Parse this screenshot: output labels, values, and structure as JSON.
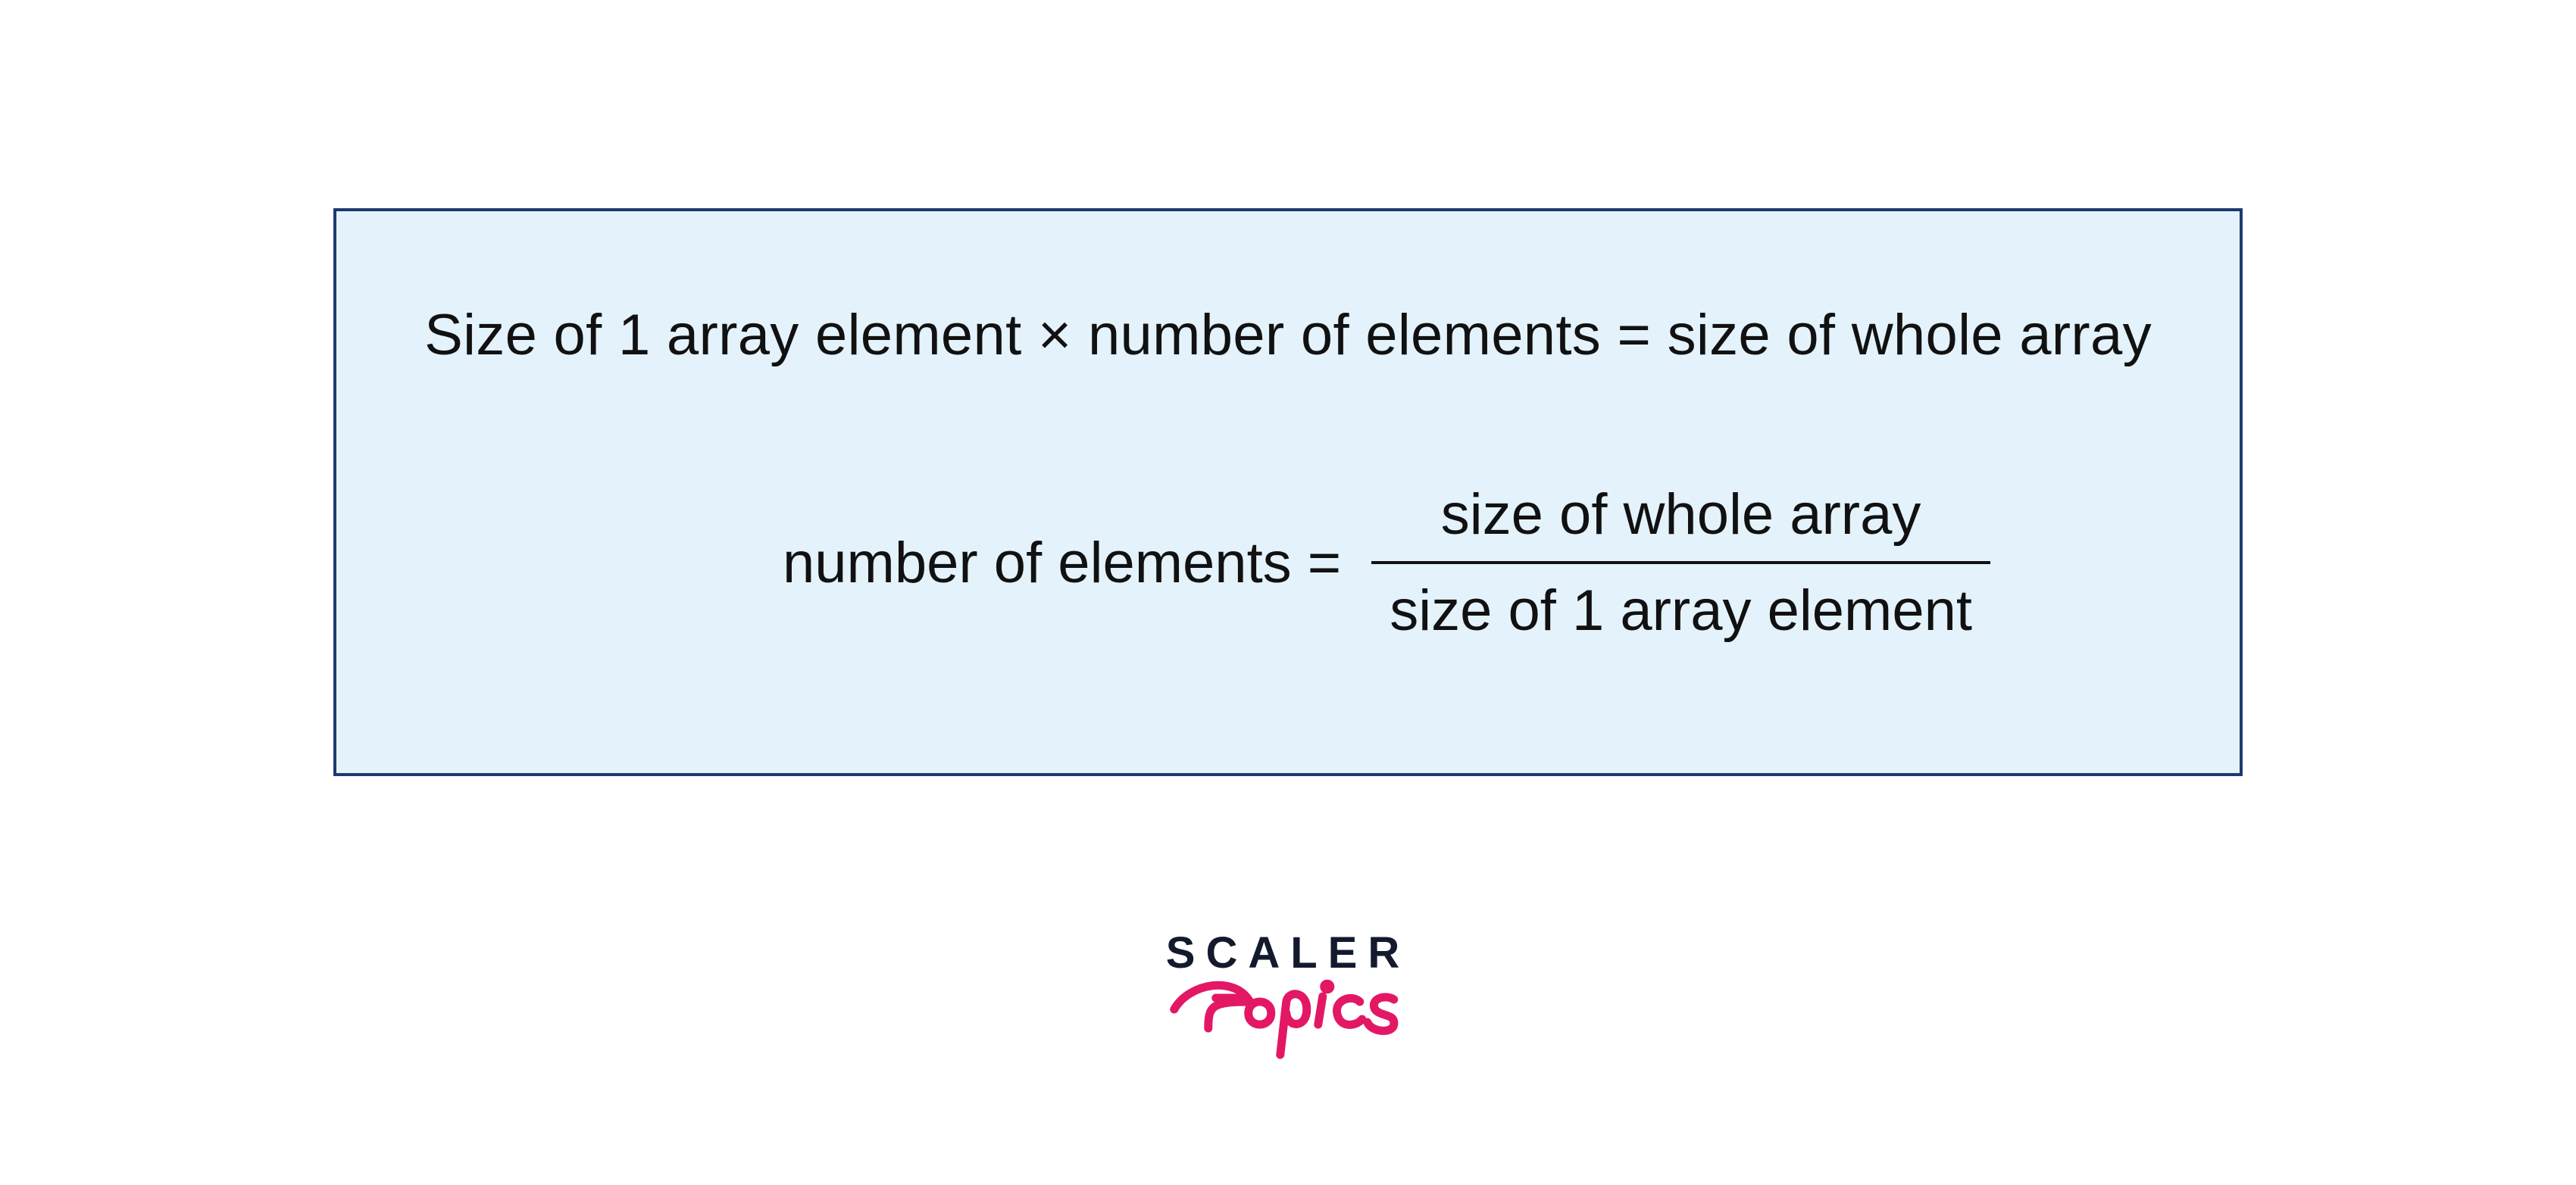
{
  "formula": {
    "equation1": "Size of 1 array element × number of elements = size of whole array",
    "equation2_lhs": "number of elements =",
    "equation2_numerator": "size of whole array",
    "equation2_denominator": "size of 1 array element"
  },
  "logo": {
    "top": "SCALER",
    "bottom": "Topics"
  },
  "colors": {
    "box_bg": "#e4f2fb",
    "box_border": "#1d3a6e",
    "text": "#111111",
    "logo_dark": "#131a2e",
    "logo_pink": "#e31864"
  }
}
